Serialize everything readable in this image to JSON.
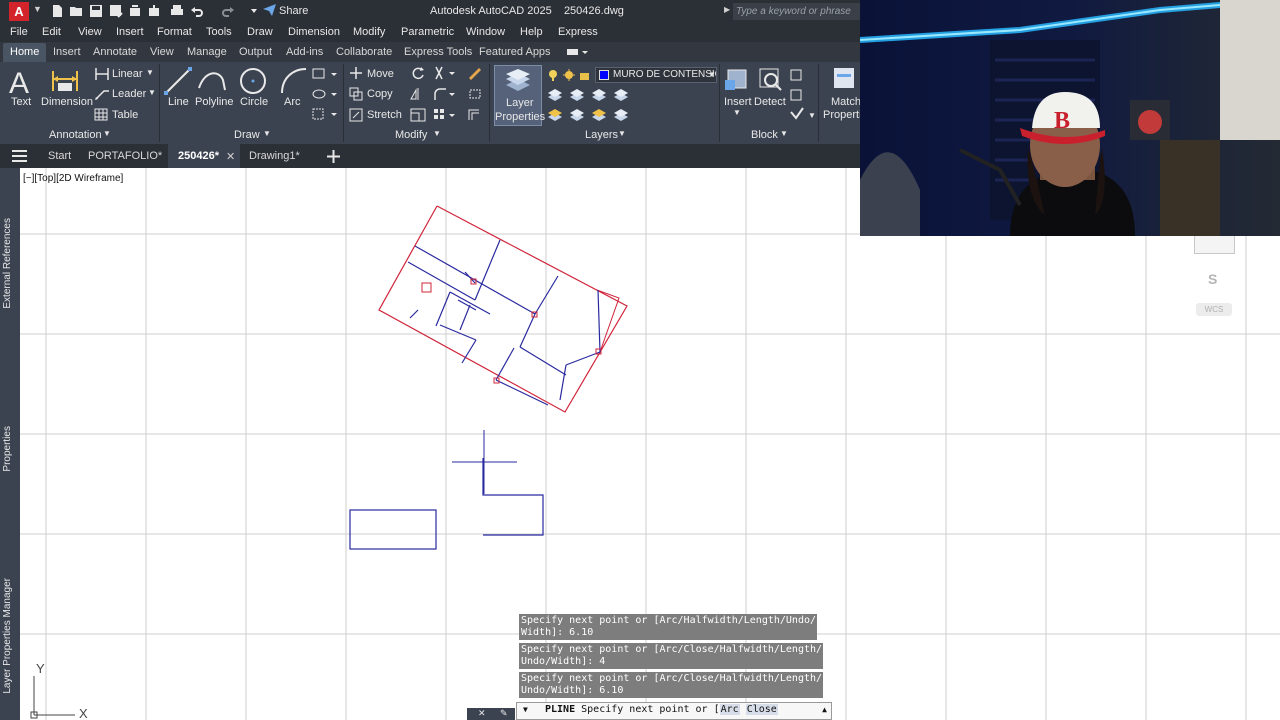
{
  "titlebar": {
    "app_title": "Autodesk AutoCAD 2025",
    "file_name": "250426.dwg",
    "logo_letter": "A",
    "share_label": "Share",
    "search_placeholder": "Type a keyword or phrase"
  },
  "menu": {
    "items": [
      "File",
      "Edit",
      "View",
      "Insert",
      "Format",
      "Tools",
      "Draw",
      "Dimension",
      "Modify",
      "Parametric",
      "Window",
      "Help",
      "Express"
    ]
  },
  "ribbon_tabs": {
    "items": [
      "Home",
      "Insert",
      "Annotate",
      "View",
      "Manage",
      "Output",
      "Add-ins",
      "Collaborate",
      "Express Tools",
      "Featured Apps"
    ]
  },
  "ribbon": {
    "annotation": {
      "text_label": "Text",
      "dimension_label": "Dimension",
      "linear_label": "Linear",
      "leader_label": "Leader",
      "table_label": "Table",
      "panel_title": "Annotation"
    },
    "draw": {
      "line_label": "Line",
      "polyline_label": "Polyline",
      "circle_label": "Circle",
      "arc_label": "Arc",
      "panel_title": "Draw"
    },
    "modify": {
      "move_label": "Move",
      "copy_label": "Copy",
      "stretch_label": "Stretch",
      "panel_title": "Modify"
    },
    "layers": {
      "layer_properties_line1": "Layer",
      "layer_properties_line2": "Properties",
      "current_layer": "MURO DE CONTENSIÓN",
      "current_layer_color": "#0000ff",
      "panel_title": "Layers"
    },
    "block": {
      "insert_label": "Insert",
      "detect_label": "Detect",
      "panel_title": "Block"
    },
    "properties": {
      "match_line1": "Match",
      "match_line2": "Properties"
    }
  },
  "file_tabs": {
    "start": "Start",
    "tabs": [
      "PORTAFOLIO*",
      "250426*",
      "Drawing1*"
    ],
    "active_index": 1
  },
  "palettes": {
    "external_references": "External References",
    "properties": "Properties",
    "layer_properties_manager": "Layer Properties Manager"
  },
  "viewport": {
    "label": "[−][Top][2D Wireframe]",
    "viewcube_direction": "S",
    "wcs_label": "WCS",
    "ucs_x": "X",
    "ucs_y": "Y"
  },
  "command": {
    "history": [
      "Specify next point or [Arc/Halfwidth/Length/Undo/\nWidth]: 6.10",
      "Specify next point or [Arc/Close/Halfwidth/Length/\nUndo/Width]: 4",
      "Specify next point or [Arc/Close/Halfwidth/Length/\nUndo/Width]: 6.10"
    ],
    "current_command": "PLINE",
    "prompt": "Specify next point or [",
    "keyword_1": "Arc",
    "keyword_2": "Close"
  },
  "colors": {
    "outline_red": "#d0243a",
    "walls_blue": "#2a2aa0",
    "grid": "#cfcfcf",
    "ribbon_bg": "#3c4350",
    "titlebar_bg": "#2b2f36"
  }
}
